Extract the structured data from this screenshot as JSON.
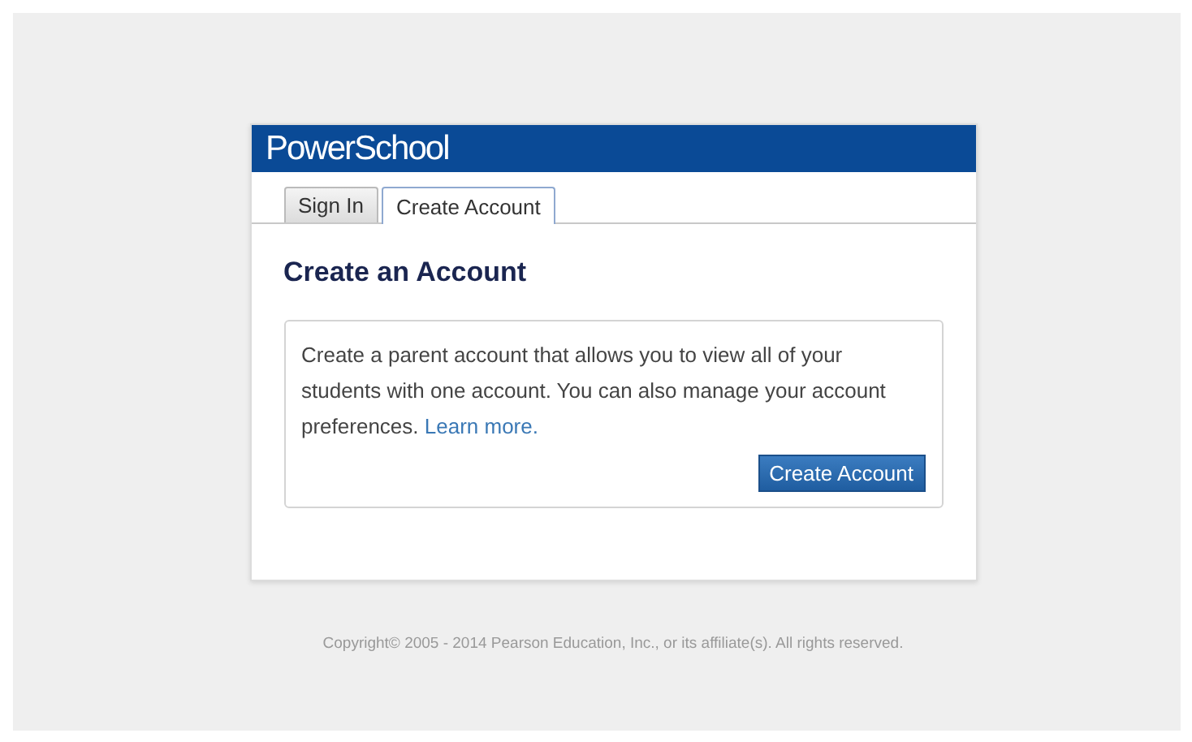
{
  "brand": "PowerSchool",
  "tabs": [
    {
      "label": "Sign In",
      "selected": false
    },
    {
      "label": "Create Account",
      "selected": true
    }
  ],
  "heading": "Create an Account",
  "description": "Create a parent account that allows you to view all of your students with one account. You can also manage your account preferences.",
  "link": "Learn more.",
  "button": "Create Account",
  "footer": "Copyright© 2005 - 2014 Pearson Education, Inc., or its affiliate(s). All rights reserved."
}
